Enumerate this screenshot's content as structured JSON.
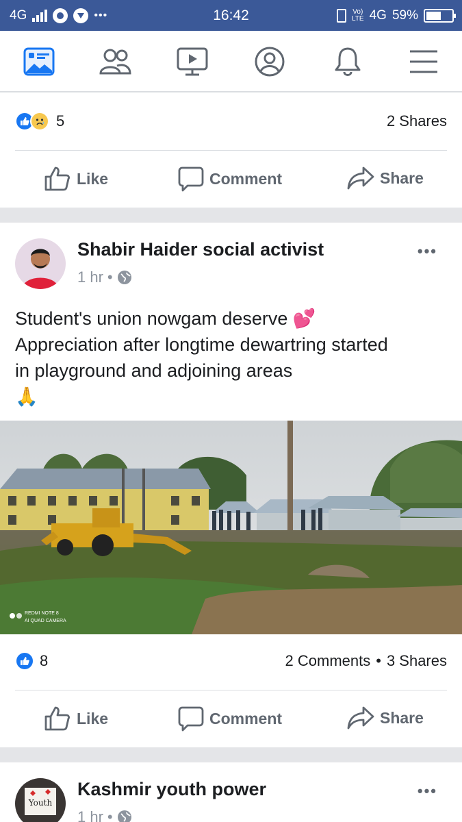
{
  "status_bar": {
    "network": "4G",
    "time": "16:42",
    "volte_top": "Vo)",
    "volte_bottom": "LTE",
    "network_right": "4G",
    "battery": "59%",
    "battery_level": 0.59
  },
  "nav": {
    "items": [
      {
        "icon": "news-feed-icon",
        "active": true
      },
      {
        "icon": "friends-icon",
        "active": false
      },
      {
        "icon": "watch-icon",
        "active": false
      },
      {
        "icon": "profile-icon",
        "active": false
      },
      {
        "icon": "notifications-icon",
        "active": false
      },
      {
        "icon": "menu-icon",
        "active": false
      }
    ]
  },
  "post1": {
    "reaction_count": "5",
    "shares": "2 Shares",
    "actions": {
      "like": "Like",
      "comment": "Comment",
      "share": "Share"
    }
  },
  "post2": {
    "author": "Shabir Haider social activist",
    "time": "1 hr",
    "dot": "•",
    "more": "•••",
    "text_line1": "Student's union nowgam deserve 💕",
    "text_line2": "Appreciation after longtime dewartring started",
    "text_line3": "in playground and adjoining areas",
    "text_line4": "🙏",
    "image_watermark_1": "REDMI NOTE 8",
    "image_watermark_2": "AI QUAD CAMERA",
    "reaction_count": "8",
    "comments": "2 Comments",
    "stats_sep": "•",
    "shares": "3 Shares",
    "actions": {
      "like": "Like",
      "comment": "Comment",
      "share": "Share"
    }
  },
  "post3": {
    "author": "Kashmir youth power",
    "time": "1 hr",
    "dot": "•",
    "more": "•••",
    "avatar_text": "Youth"
  },
  "colors": {
    "brand": "#3b5998",
    "like_blue": "#1877f2",
    "text": "#1c1e21",
    "muted": "#606770"
  }
}
